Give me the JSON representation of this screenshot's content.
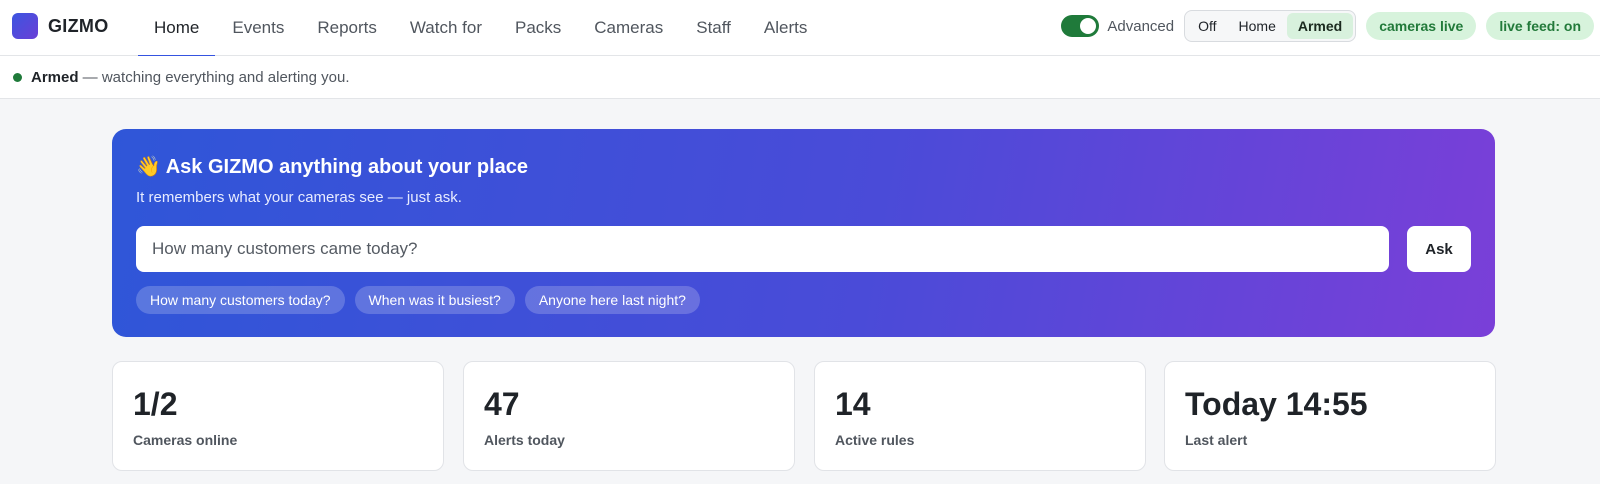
{
  "brand": {
    "name": "GIZMO",
    "logo_icon": "gizmo-logo-icon"
  },
  "nav": {
    "items": [
      {
        "label": "Home",
        "active": true
      },
      {
        "label": "Events",
        "active": false
      },
      {
        "label": "Reports",
        "active": false
      },
      {
        "label": "Watch for",
        "active": false
      },
      {
        "label": "Packs",
        "active": false
      },
      {
        "label": "Cameras",
        "active": false
      },
      {
        "label": "Staff",
        "active": false
      },
      {
        "label": "Alerts",
        "active": false
      }
    ]
  },
  "controls": {
    "advanced_label": "Advanced",
    "advanced_on": true,
    "mode_options": [
      "Off",
      "Home",
      "Armed"
    ],
    "mode_selected": "Armed",
    "cameras_pill": "cameras live",
    "feed_pill": "live feed: on"
  },
  "status": {
    "title": "Armed",
    "text": " — watching everything and alerting you.",
    "dot_color": "#1f7a3a"
  },
  "hero": {
    "emoji": "👋",
    "title": "Ask GIZMO anything about your place",
    "subtitle": "It remembers what your cameras see — just ask.",
    "input_placeholder": "How many customers came today?",
    "ask_label": "Ask",
    "chips": [
      "How many customers today?",
      "When was it busiest?",
      "Anyone here last night?"
    ]
  },
  "stats": [
    {
      "value": "1/2",
      "label": "Cameras online"
    },
    {
      "value": "47",
      "label": "Alerts today"
    },
    {
      "value": "14",
      "label": "Active rules"
    },
    {
      "value": "Today 14:55",
      "label": "Last alert"
    }
  ],
  "colors": {
    "accent": "#3553e0",
    "armed_green": "#1f7a3a",
    "pill_bg": "#d7f3dc",
    "hero_gradient": [
      "#2f56d8",
      "#7a3fd8"
    ]
  }
}
